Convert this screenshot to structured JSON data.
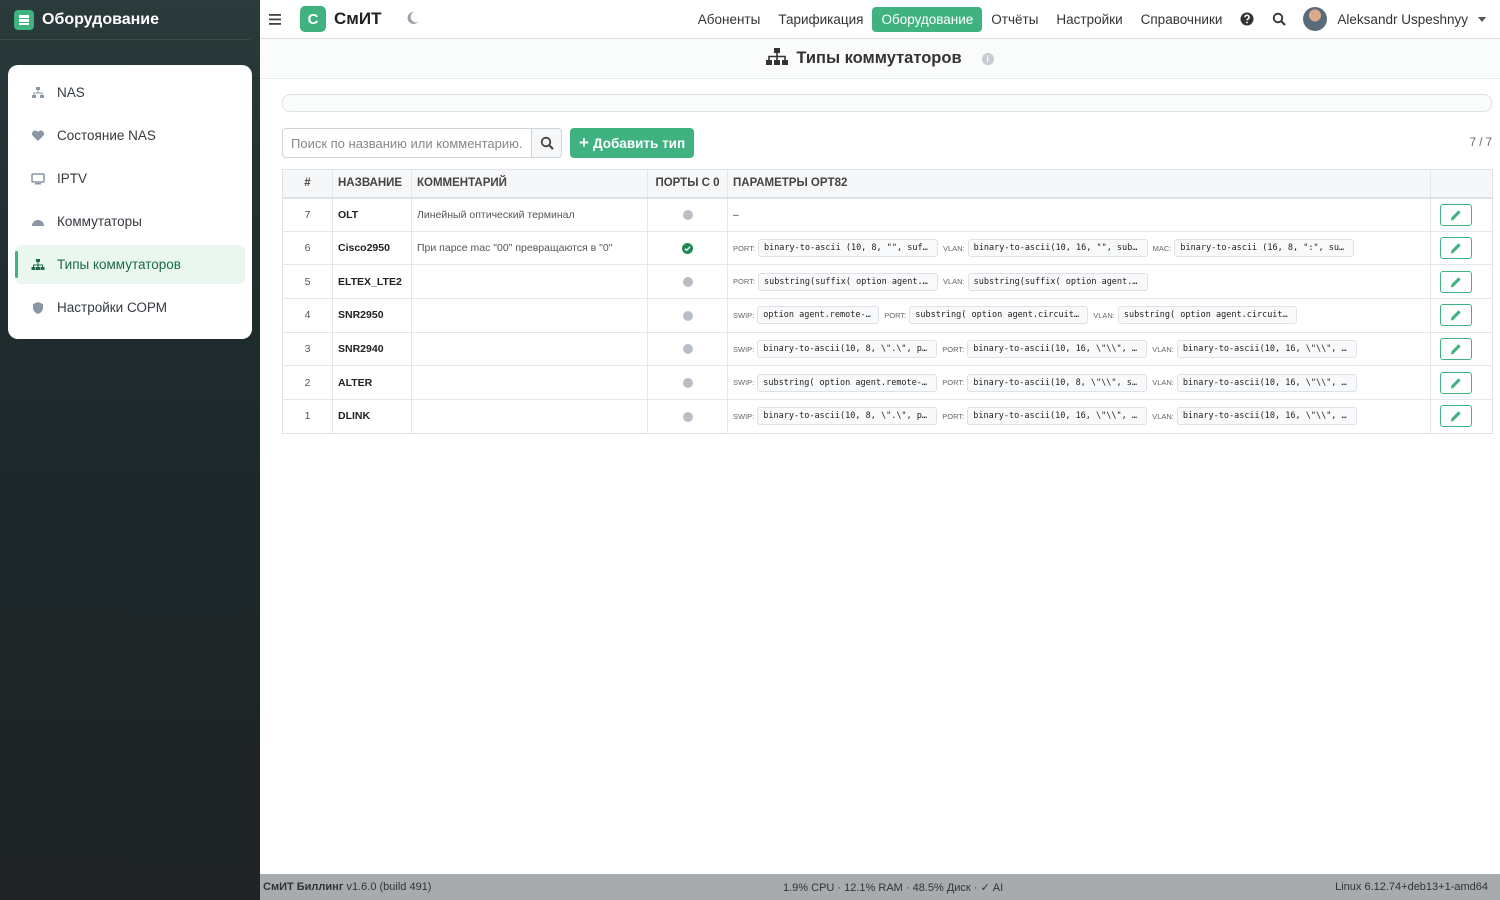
{
  "sidebar": {
    "title": "Оборудование",
    "items": [
      {
        "label": "NAS",
        "icon": "network-icon"
      },
      {
        "label": "Состояние NAS",
        "icon": "heartbeat-icon"
      },
      {
        "label": "IPTV",
        "icon": "tv-icon"
      },
      {
        "label": "Коммутаторы",
        "icon": "switch-icon"
      },
      {
        "label": "Типы коммутаторов",
        "icon": "sitemap-icon",
        "active": true
      },
      {
        "label": "Настройки СОРМ",
        "icon": "shield-icon"
      }
    ]
  },
  "navbar": {
    "logo_letter": "С",
    "logo_text": "СмИТ",
    "links": [
      "Абоненты",
      "Тарификация",
      "Оборудование",
      "Отчёты",
      "Настройки",
      "Справочники"
    ],
    "active_link": "Оборудование",
    "user_name": "Aleksandr Uspeshnyy"
  },
  "page": {
    "title": "Типы коммутаторов"
  },
  "toolbar": {
    "search_placeholder": "Поиск по названию или комментарию...",
    "add_label": "Добавить тип",
    "counter": "7 / 7"
  },
  "table": {
    "headers": [
      "#",
      "НАЗВАНИЕ",
      "КОММЕНТАРИЙ",
      "ПОРТЫ С 0",
      "ПАРАМЕТРЫ OPT82",
      ""
    ],
    "rows": [
      {
        "num": "7",
        "name": "OLT",
        "comment": "Линейный оптический терминал",
        "ports0": false,
        "params": [],
        "empty": "–"
      },
      {
        "num": "6",
        "name": "Cisco2950",
        "comment": "При парсе mac \"00\" превращаются в \"0\"",
        "ports0": true,
        "params": [
          {
            "label": "PORT:",
            "value": "binary-to-ascii (10, 8, \"\", suff…"
          },
          {
            "label": "VLAN:",
            "value": "binary-to-ascii(10, 16, \"\", suba…"
          },
          {
            "label": "MAC:",
            "value": "binary-to-ascii (16, 8, \":\", suf…"
          }
        ]
      },
      {
        "num": "5",
        "name": "ELTEX_LTE2",
        "comment": "",
        "ports0": false,
        "params": [
          {
            "label": "PORT:",
            "value": "substring(suffix( option agent.c…"
          },
          {
            "label": "VLAN:",
            "value": "substring(suffix( option agent.c…"
          }
        ]
      },
      {
        "num": "4",
        "name": "SNR2950",
        "comment": "",
        "ports0": false,
        "params": [
          {
            "label": "SWIP:",
            "value": "option agent.remote-id"
          },
          {
            "label": "PORT:",
            "value": "substring( option agent.circuit-…"
          },
          {
            "label": "VLAN:",
            "value": "substring( option agent.circuit-…"
          }
        ]
      },
      {
        "num": "3",
        "name": "SNR2940",
        "comment": "",
        "ports0": false,
        "params": [
          {
            "label": "SWIP:",
            "value": "binary-to-ascii(10, 8, \\\".\\\", pa…"
          },
          {
            "label": "PORT:",
            "value": "binary-to-ascii(10, 16, \\\"\\\\\", su…"
          },
          {
            "label": "VLAN:",
            "value": "binary-to-ascii(10, 16, \\\"\\\\\", su…"
          }
        ]
      },
      {
        "num": "2",
        "name": "ALTER",
        "comment": "",
        "ports0": false,
        "params": [
          {
            "label": "SWIP:",
            "value": "substring( option agent.remote-i…"
          },
          {
            "label": "PORT:",
            "value": "binary-to-ascii(10, 8, \\\"\\\\\", suf…"
          },
          {
            "label": "VLAN:",
            "value": "binary-to-ascii(10, 16, \\\"\\\\\", su…"
          }
        ]
      },
      {
        "num": "1",
        "name": "DLINK",
        "comment": "",
        "ports0": false,
        "params": [
          {
            "label": "SWIP:",
            "value": "binary-to-ascii(10, 8, \\\".\\\", pa…"
          },
          {
            "label": "PORT:",
            "value": "binary-to-ascii(10, 16, \\\"\\\\\", su…"
          },
          {
            "label": "VLAN:",
            "value": "binary-to-ascii(10, 16, \\\"\\\\\", su…"
          }
        ]
      }
    ]
  },
  "footer": {
    "app": "СмИТ Биллинг",
    "version": "v1.6.0 (build 491)",
    "stats": "1.9% CPU · 12.1% RAM · 48.5% Диск · ✓ AI",
    "os": "Linux 6.12.74+deb13+1-amd64"
  },
  "colors": {
    "accent": "#3fb27f",
    "sidebar_bg": "#1f2a2c",
    "footer_bg": "#a8abae"
  }
}
